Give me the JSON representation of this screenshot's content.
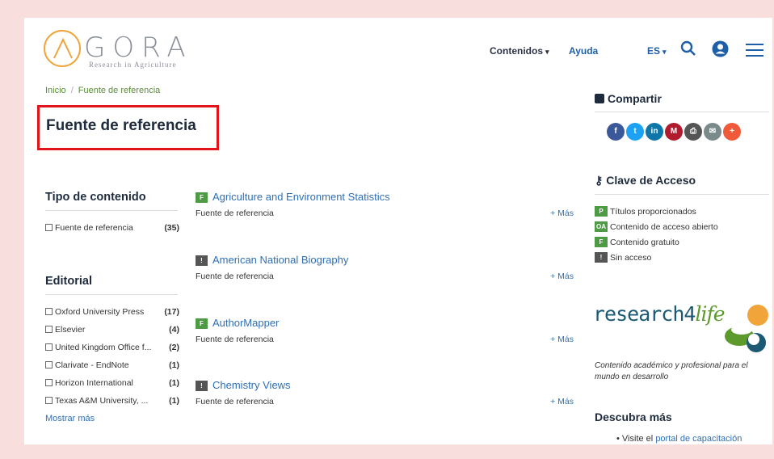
{
  "header": {
    "logo_name": "GORA",
    "logo_tagline": "Research in Agriculture",
    "nav_contenidos": "Contenidos",
    "nav_ayuda": "Ayuda",
    "lang": "ES",
    "accent": "#1f5fa8",
    "logo_color": "#f0a43a"
  },
  "breadcrumb": {
    "home": "Inicio",
    "separator": "/",
    "current": "Fuente de referencia"
  },
  "page_title": "Fuente de referencia",
  "facets": {
    "tipo": {
      "heading": "Tipo de contenido",
      "items": [
        {
          "label": "Fuente de referencia",
          "count": "(35)"
        }
      ]
    },
    "editorial": {
      "heading": "Editorial",
      "items": [
        {
          "label": "Oxford University Press",
          "count": "(17)"
        },
        {
          "label": "Elsevier",
          "count": "(4)"
        },
        {
          "label": "United Kingdom Office f...",
          "count": "(2)"
        },
        {
          "label": "Clarivate - EndNote",
          "count": "(1)"
        },
        {
          "label": "Horizon International",
          "count": "(1)"
        },
        {
          "label": "Texas A&M University, ...",
          "count": "(1)"
        }
      ],
      "show_more": "Mostrar más"
    }
  },
  "results": [
    {
      "badge": "F",
      "badge_color": "#4f9a45",
      "title": "Agriculture and Environment Statistics",
      "type": "Fuente de referencia",
      "more": "+ Más"
    },
    {
      "badge": "!",
      "badge_color": "#555555",
      "title": "American National Biography",
      "type": "Fuente de referencia",
      "more": "+ Más"
    },
    {
      "badge": "F",
      "badge_color": "#4f9a45",
      "title": "AuthorMapper",
      "type": "Fuente de referencia",
      "more": "+ Más"
    },
    {
      "badge": "!",
      "badge_color": "#555555",
      "title": "Chemistry Views",
      "type": "Fuente de referencia",
      "more": "+ Más"
    }
  ],
  "sidebar": {
    "share_heading": "Compartir",
    "social": [
      {
        "name": "facebook-icon",
        "glyph": "f",
        "color": "#3b5998"
      },
      {
        "name": "twitter-icon",
        "glyph": "t",
        "color": "#1da1f2"
      },
      {
        "name": "linkedin-icon",
        "glyph": "in",
        "color": "#0e76a8"
      },
      {
        "name": "mendeley-icon",
        "glyph": "M",
        "color": "#b01c2e"
      },
      {
        "name": "print-icon",
        "glyph": "⎙",
        "color": "#555555"
      },
      {
        "name": "email-icon",
        "glyph": "✉",
        "color": "#7a8a8a"
      },
      {
        "name": "plus-icon",
        "glyph": "+",
        "color": "#f05a3a"
      }
    ],
    "key_heading": "Clave de Acceso",
    "key_items": [
      {
        "badge": "P",
        "color": "#4f9a45",
        "label": "Títulos proporcionados"
      },
      {
        "badge": "OA",
        "color": "#4f9a45",
        "label": "Contenido de acceso abierto"
      },
      {
        "badge": "F",
        "color": "#4f9a45",
        "label": "Contenido gratuito"
      },
      {
        "badge": "!",
        "color": "#555555",
        "label": "Sin acceso"
      }
    ],
    "r4l_main": "research4",
    "r4l_life": "life",
    "r4l_desc": "Contenido académico y profesional para el mundo en desarrollo",
    "discover_heading": "Descubra más",
    "visit_prefix": "Visite el",
    "visit_link": "portal de capacitación"
  }
}
